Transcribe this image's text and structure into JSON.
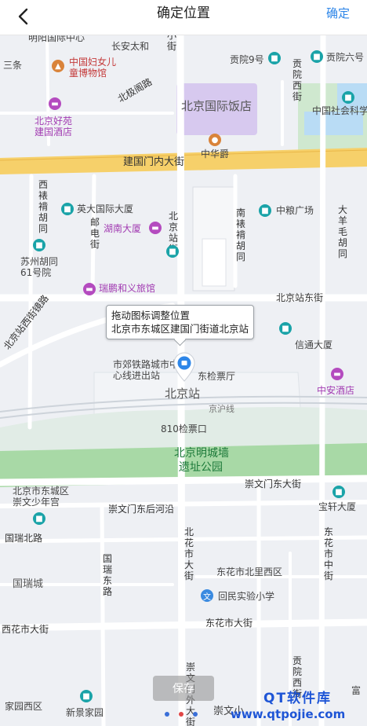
{
  "header": {
    "title": "确定位置",
    "confirm_label": "确定",
    "back_icon": "chevron-left-icon"
  },
  "tooltip": {
    "line1": "拖动图标调整位置",
    "line2": "北京市东城区建国门街道北京站"
  },
  "save_label": "保存",
  "watermark": {
    "line1": "QT软件库",
    "line2": "www.qtpojie.com"
  },
  "map": {
    "roads": {
      "jianguomennei": "建国门内大街",
      "beijingzhan_jie": "北京站街",
      "beijingzhan_dongjie": "北京站东街",
      "beijingzhan_xijie": "北京站西街镜路",
      "chongwenmen_dongjie": "崇文门东大街",
      "chongwenmen_donghou": "崇文门东后河沿",
      "beijijge": "北极阁路",
      "dongdan": "小街",
      "dayang": "大羊毛胡同",
      "xiguan": "西裱褙胡同",
      "nanbiao": "南裱褙胡同",
      "youjie": "邮电街",
      "guorui": "国瑞东路",
      "guoruibei": "国瑞北路",
      "dongzhong": "东花市中街",
      "dongnan": "北花市大街",
      "dongbei": "东花市北里西区",
      "dongdajie": "东花市大街",
      "xidajie": "西花市大街",
      "gongyuan": "贡院西街",
      "huashi": "崇文门外大街",
      "jinghu": "京沪线",
      "suzhou": "苏州胡同61号院"
    },
    "places": {
      "mingyang": "明阳国际中心",
      "changan": "长安太和",
      "sanliao": "三条",
      "funv": "中国妇女儿童博物馆",
      "hotel_haoyuan": "北京好苑建国酒店",
      "guoji": "北京国际饭店",
      "zhonghuajue": "中华爵",
      "yingda": "英大国际大厦",
      "hunan": "湖南大厦",
      "suzhou": "苏州胡同61号院",
      "ruipeng": "瑞鹏和义旅馆",
      "zhongliang": "中粮广场",
      "xintong": "信通大厦",
      "zhongan": "中安酒店",
      "gongyuan9": "贡院9号",
      "gongyuan6": "贡院六号",
      "shehui": "中国社会科学",
      "tielu": "市郊铁路城市中心线进出站",
      "dongjian": "东检票厅",
      "beijingzhan": "北京站",
      "jian810": "810检票口",
      "park_line1": "北京明城墙",
      "park_line2": "遗址公园",
      "shaonian": "北京市东城区崇文少年宫",
      "baoxuan": "宝轩大厦",
      "guorui_city": "国瑞城",
      "huimin": "回民实验小学",
      "jiayuan": "家园西区",
      "xinjing": "新景家园",
      "chongwen": "崇文小",
      "fuyu": "富"
    }
  },
  "colors": {
    "accent": "#2e86e8",
    "main_road": "#f6d06a",
    "green": "#cfe8cf",
    "water": "#b9dcf5",
    "purple_block": "#d7c9ef"
  }
}
